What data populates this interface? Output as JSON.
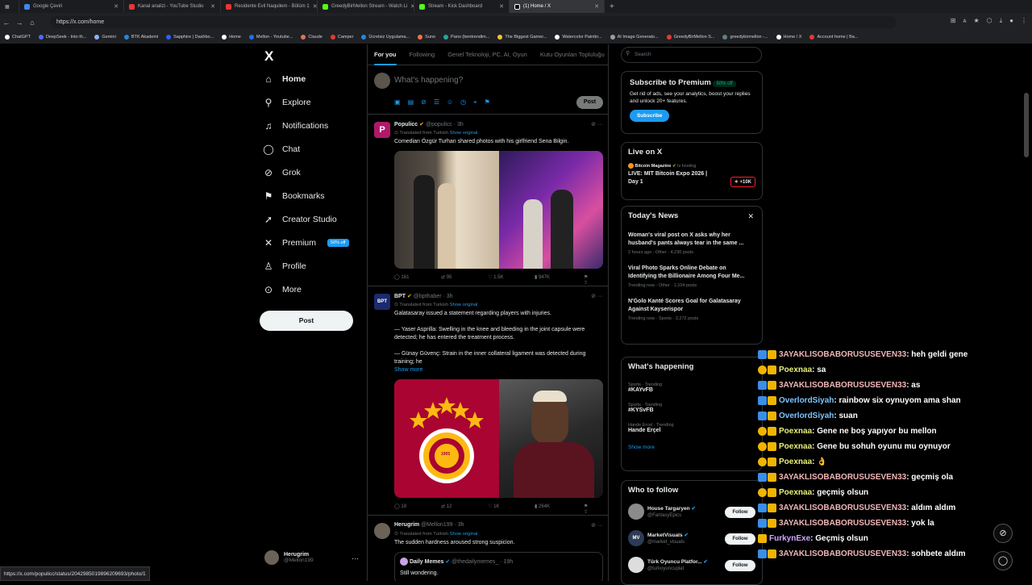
{
  "browser": {
    "tabs": [
      {
        "label": "Google Çeviri",
        "color": "#4285f4"
      },
      {
        "label": "Kanal analizi - YouTube Studio",
        "color": "#e33"
      },
      {
        "label": "Residente Evil Naquilem - Bölüm 1",
        "color": "#e33"
      },
      {
        "label": "GreedyBirMellon Stream - Watch Li",
        "color": "#53fc18"
      },
      {
        "label": "Stream - Kick Dashboard",
        "color": "#53fc18"
      },
      {
        "label": "(1) Home / X",
        "color": "#ffffff"
      }
    ],
    "url": "https://x.com/home",
    "bookmarks": [
      {
        "label": "ChatGPT",
        "color": "#ffffff"
      },
      {
        "label": "DeepSeek - Into th...",
        "color": "#4d6bfe"
      },
      {
        "label": "Gemini",
        "color": "#8ab4f8"
      },
      {
        "label": "BTK Akademi",
        "color": "#1e88e5"
      },
      {
        "label": "Sapphire | Dashbo...",
        "color": "#2962ff"
      },
      {
        "label": "Home",
        "color": "#ffffff"
      },
      {
        "label": "Mellon - Youtube...",
        "color": "#1a73e8"
      },
      {
        "label": "Claude",
        "color": "#d97757"
      },
      {
        "label": "Camper",
        "color": "#e53935"
      },
      {
        "label": "Ücretsiz Uygulama...",
        "color": "#1e88e5"
      },
      {
        "label": "Suno",
        "color": "#ff7043"
      },
      {
        "label": "Pano (bentrendim...",
        "color": "#26a69a"
      },
      {
        "label": "The Biggest Gamer...",
        "color": "#fbc02d"
      },
      {
        "label": "Watercolor Paintin...",
        "color": "#ffffff"
      },
      {
        "label": "AI Image Generato...",
        "color": "#9e9e9e"
      },
      {
        "label": "GreedyBirMellon S...",
        "color": "#e53935"
      },
      {
        "label": "greedybirmellon -...",
        "color": "#607d8b"
      },
      {
        "label": "Home / X",
        "color": "#ffffff"
      },
      {
        "label": "Account home | Ba...",
        "color": "#e53935"
      }
    ]
  },
  "nav": {
    "logo": "X",
    "items": [
      {
        "label": "Home",
        "icon": "⌂"
      },
      {
        "label": "Explore",
        "icon": "⚲"
      },
      {
        "label": "Notifications",
        "icon": "♫"
      },
      {
        "label": "Chat",
        "icon": "◯"
      },
      {
        "label": "Grok",
        "icon": "⊘"
      },
      {
        "label": "Bookmarks",
        "icon": "⚑"
      },
      {
        "label": "Creator Studio",
        "icon": "➚"
      },
      {
        "label": "Premium",
        "icon": "✕",
        "badge": "50% off"
      },
      {
        "label": "Profile",
        "icon": "♙"
      },
      {
        "label": "More",
        "icon": "⊙"
      }
    ],
    "post_label": "Post",
    "profile_name": "Herugrim",
    "profile_handle": "@Mellon199"
  },
  "feed": {
    "tabs": [
      "For you",
      "Following",
      "Genel Teknoloji, PC, AI, Oyun",
      "Kutu Oyunları Topluluğu"
    ],
    "compose_placeholder": "What's happening?",
    "post_label": "Post",
    "tweets": [
      {
        "name": "Populicc",
        "handle": "@populicc · 3h",
        "translated": "Translated from Turkish",
        "show_original": "Show original",
        "text": "Comedian Özgür Turhan shared photos with his girlfriend Sena Bilgin.",
        "replies": "161",
        "reposts": "95",
        "likes": "1.5K",
        "views": "947K",
        "avatar_color": "#b0186a"
      },
      {
        "name": "BPT",
        "handle": "@bpthaber · 3h",
        "translated": "Translated from Turkish",
        "show_original": "Show original",
        "text1": "Galatasaray issued a statement regarding players with injuries.",
        "text2": "— Yaser Asprilla: Swelling in the knee and bleeding in the joint capsule were detected; he has entered the treatment process.",
        "text3": "— Günay Güvenç: Strain in the inner collateral ligament was detected during training; he",
        "show_more": "Show more",
        "replies": "18",
        "reposts": "12",
        "likes": "1K",
        "views": "264K",
        "avatar_color": "#1a2a6c",
        "emblem_year": "1905"
      },
      {
        "name": "Herugrim",
        "handle": "@Mellon199 · 3h",
        "translated": "Translated from Turkish",
        "show_original": "Show original",
        "text": "The sudden hardness aroused strong suspicion.",
        "quote_name": "Daily Memes",
        "quote_handle": "@thedailymemes_ · 19h",
        "quote_text": "Still wondering.",
        "avatar_color": "#6b6358"
      }
    ]
  },
  "sidebar": {
    "search_placeholder": "Search",
    "premium": {
      "title": "Subscribe to Premium",
      "badge": "50% off",
      "text": "Get rid of ads, see your analytics, boost your replies and unlock 20+ features.",
      "button": "Subscribe"
    },
    "live": {
      "title": "Live on X",
      "host": "Bitcoin Magazine",
      "hosting": "is hosting",
      "event": "LIVE: MIT Bitcoin Expo 2026 | Day 1",
      "count": "+10K"
    },
    "news": {
      "title": "Today's News",
      "items": [
        {
          "headline": "Woman's viral post on X asks why her husband's pants always tear in the same ...",
          "meta": "2 hours ago · Other · 4,230 posts"
        },
        {
          "headline": "Viral Photo Sparks Online Debate on Identifying the Billionaire Among Four Me...",
          "meta": "Trending now · Other · 1,104 posts"
        },
        {
          "headline": "N'Golo Kanté Scores Goal for Galatasaray Against Kayserispor",
          "meta": "Trending now · Sports · 3,272 posts"
        }
      ]
    },
    "happening": {
      "title": "What's happening",
      "items": [
        {
          "meta": "Sports · Trending",
          "name": "#KAYvFB"
        },
        {
          "meta": "Sports · Trending",
          "name": "#KYSvFB"
        },
        {
          "meta": "Hande Ercel · Trending",
          "name": "Hande Erçel"
        }
      ],
      "show_more": "Show more"
    },
    "follow": {
      "title": "Who to follow",
      "button": "Follow",
      "accounts": [
        {
          "name": "House Targaryen",
          "handle": "@FantasyEpics",
          "color": "#8a8a8a"
        },
        {
          "name": "MarketVisuals",
          "handle": "@market_visuals",
          "color": "#2d3b55"
        },
        {
          "name": "Türk Oyuncu Platfor...",
          "handle": "@turkoyuncuplat",
          "color": "#dddddd"
        }
      ]
    }
  },
  "chat": {
    "messages": [
      {
        "user": "3AYAKLISOBABORUSUSEVEN33",
        "msg": ": heh geldi gene",
        "cls": "u1",
        "b1": "#3a8ee6",
        "b2": "#f0b400"
      },
      {
        "user": "Poexnaa",
        "msg": ": sa",
        "cls": "u2",
        "b1": "#f0b400",
        "b2": "#f0b400"
      },
      {
        "user": "3AYAKLISOBABORUSUSEVEN33",
        "msg": ": as",
        "cls": "u1",
        "b1": "#3a8ee6",
        "b2": "#f0b400"
      },
      {
        "user": "OverlordSiyah",
        "msg": ": rainbow six oynuyom ama shan",
        "cls": "u3",
        "b1": "#3a8ee6",
        "b2": "#f0b400"
      },
      {
        "user": "OverlordSiyah",
        "msg": ": suan",
        "cls": "u3",
        "b1": "#3a8ee6",
        "b2": "#f0b400"
      },
      {
        "user": "Poexnaa",
        "msg": ": Gene ne boş yapıyor bu mellon",
        "cls": "u2",
        "b1": "#f0b400",
        "b2": "#f0b400"
      },
      {
        "user": "Poexnaa",
        "msg": ": Gene bu sohuh oyunu mu oynuyor",
        "cls": "u2",
        "b1": "#f0b400",
        "b2": "#f0b400"
      },
      {
        "user": "Poexnaa",
        "msg": ": 👌",
        "cls": "u2",
        "b1": "#f0b400",
        "b2": "#f0b400"
      },
      {
        "user": "3AYAKLISOBABORUSUSEVEN33",
        "msg": ": geçmiş ola",
        "cls": "u1",
        "b1": "#3a8ee6",
        "b2": "#f0b400"
      },
      {
        "user": "Poexnaa",
        "msg": ": geçmiş olsun",
        "cls": "u2",
        "b1": "#f0b400",
        "b2": "#f0b400"
      },
      {
        "user": "3AYAKLISOBABORUSUSEVEN33",
        "msg": ": aldım aldım",
        "cls": "u1",
        "b1": "#3a8ee6",
        "b2": "#f0b400"
      },
      {
        "user": "3AYAKLISOBABORUSUSEVEN33",
        "msg": ": yok la",
        "cls": "u1",
        "b1": "#3a8ee6",
        "b2": "#f0b400"
      },
      {
        "user": "FurkynExe",
        "msg": ": Geçmiş olsun",
        "cls": "u4",
        "b1": "#f0b400",
        "b2": "#f0b400"
      },
      {
        "user": "3AYAKLISOBABORUSUSEVEN33",
        "msg": ": sohbete aldım",
        "cls": "u1",
        "b1": "#3a8ee6",
        "b2": "#f0b400"
      }
    ]
  },
  "status_url": "https://x.com/populicc/status/2042985019896209693/photo/1"
}
